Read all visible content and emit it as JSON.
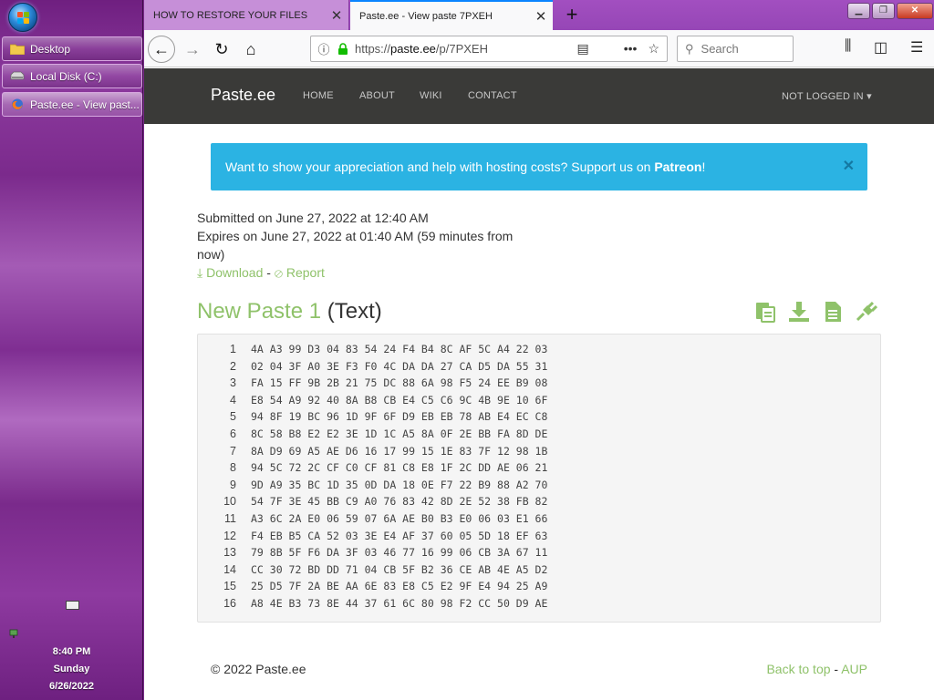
{
  "taskbar": {
    "items": [
      {
        "label": "Desktop",
        "icon": "folder-icon"
      },
      {
        "label": "Local Disk (C:)",
        "icon": "drive-icon"
      },
      {
        "label": "Paste.ee - View past...",
        "icon": "firefox-icon"
      }
    ],
    "clock": {
      "time": "8:40 PM",
      "day": "Sunday",
      "date": "6/26/2022"
    }
  },
  "browser": {
    "tabs": [
      {
        "title": "HOW TO RESTORE YOUR FILES",
        "active": false
      },
      {
        "title": "Paste.ee - View paste 7PXEH",
        "active": true
      }
    ],
    "url_prefix": "https://",
    "url_host": "paste.ee",
    "url_path": "/p/7PXEH",
    "search_placeholder": "Search"
  },
  "site": {
    "brand": "Paste.ee",
    "nav": [
      "HOME",
      "ABOUT",
      "WIKI",
      "CONTACT"
    ],
    "account": "NOT LOGGED IN",
    "alert_text": "Want to show your appreciation and help with hosting costs? Support us on ",
    "alert_link": "Patreon",
    "alert_suffix": "!",
    "submitted": "Submitted on June 27, 2022 at 12:40 AM",
    "expires": "Expires on June 27, 2022 at 01:40 AM (59 minutes from now)",
    "download": "Download",
    "report": "Report",
    "paste_name": "New Paste 1",
    "paste_type": "(Text)",
    "footer_copy": "© 2022 Paste.ee",
    "footer_top": "Back to top",
    "footer_aup": "AUP"
  },
  "code_lines": [
    "4A A3 99 D3 04 83 54 24 F4 B4 8C AF 5C A4 22 03",
    "02 04 3F A0 3E F3 F0 4C DA DA 27 CA D5 DA 55 31",
    "FA 15 FF 9B 2B 21 75 DC 88 6A 98 F5 24 EE B9 08",
    "E8 54 A9 92 40 8A B8 CB E4 C5 C6 9C 4B 9E 10 6F",
    "94 8F 19 BC 96 1D 9F 6F D9 EB EB 78 AB E4 EC C8",
    "8C 58 B8 E2 E2 3E 1D 1C A5 8A 0F 2E BB FA 8D DE",
    "8A D9 69 A5 AE D6 16 17 99 15 1E 83 7F 12 98 1B",
    "94 5C 72 2C CF C0 CF 81 C8 E8 1F 2C DD AE 06 21",
    "9D A9 35 BC 1D 35 0D DA 18 0E F7 22 B9 88 A2 70",
    "54 7F 3E 45 BB C9 A0 76 83 42 8D 2E 52 38 FB 82",
    "A3 6C 2A E0 06 59 07 6A AE B0 B3 E0 06 03 E1 66",
    "F4 EB B5 CA 52 03 3E E4 AF 37 60 05 5D 18 EF 63",
    "79 8B 5F F6 DA 3F 03 46 77 16 99 06 CB 3A 67 11",
    "CC 30 72 BD DD 71 04 CB 5F B2 36 CE AB 4E A5 D2",
    "25 D5 7F 2A BE AA 6E 83 E8 C5 E2 9F E4 94 25 A9",
    "A8 4E B3 73 8E 44 37 61 6C 80 98 F2 CC 50 D9 AE"
  ],
  "colors": {
    "accent_green": "#8fc26a",
    "alert_blue": "#2bb3e3",
    "nav_dark": "#3a3a38",
    "taskbar_purple": "#7a2a8a"
  }
}
